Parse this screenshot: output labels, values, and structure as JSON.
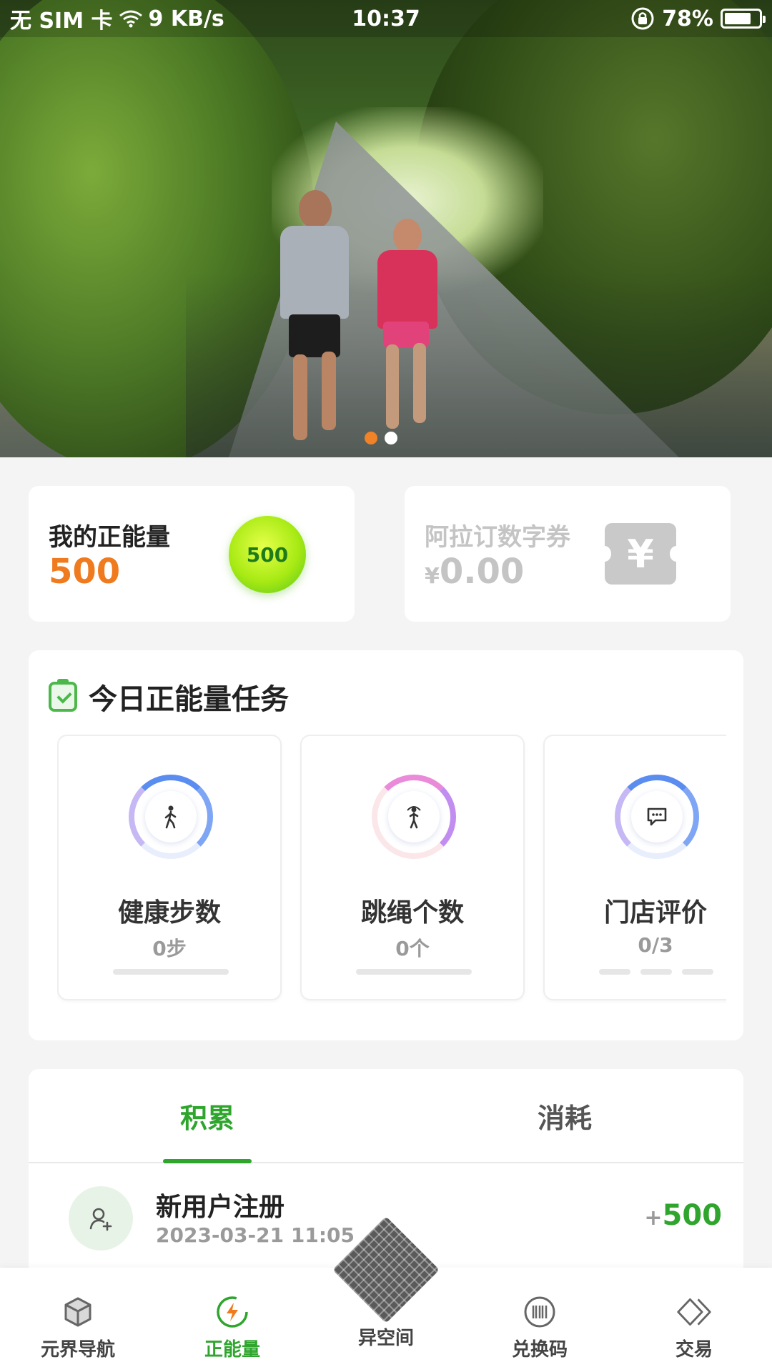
{
  "status_bar": {
    "carrier": "无 SIM 卡",
    "network_speed": "9 KB/s",
    "time": "10:37",
    "battery": "78%",
    "battery_level": 0.78
  },
  "banner": {
    "slide_count": 2,
    "active_slide": 1
  },
  "energy": {
    "title": "我的正能量",
    "value": "500",
    "orb_value": "500"
  },
  "voucher": {
    "title": "阿拉订数字券",
    "currency": "¥",
    "value": "0.00",
    "icon_symbol": "¥"
  },
  "tasks": {
    "title": "今日正能量任务",
    "items": [
      {
        "name": "健康步数",
        "value": "0步",
        "icon": "walking-person-icon"
      },
      {
        "name": "跳绳个数",
        "value": "0个",
        "icon": "jump-rope-icon"
      },
      {
        "name": "门店评价",
        "value": "0/3",
        "icon": "comment-icon"
      }
    ]
  },
  "records": {
    "tabs": [
      "积累",
      "消耗"
    ],
    "active_tab": 0,
    "items": [
      {
        "title": "新用户注册",
        "time": "2023-03-21 11:05",
        "sign": "+",
        "amount": "500",
        "icon": "add-user-icon"
      }
    ]
  },
  "bottom_nav": {
    "items": [
      {
        "label": "元界导航",
        "icon": "cube-icon"
      },
      {
        "label": "正能量",
        "icon": "energy-icon",
        "active": true
      },
      {
        "label": "异空间",
        "icon": "diamond-grid-icon"
      },
      {
        "label": "兑换码",
        "icon": "barcode-icon"
      },
      {
        "label": "交易",
        "icon": "trade-diamond-icon"
      }
    ]
  },
  "colors": {
    "accent_green": "#2fa52e",
    "energy_orange": "#f07a1e",
    "muted_gray": "#c4c4c4",
    "carousel_active": "#f08228"
  }
}
